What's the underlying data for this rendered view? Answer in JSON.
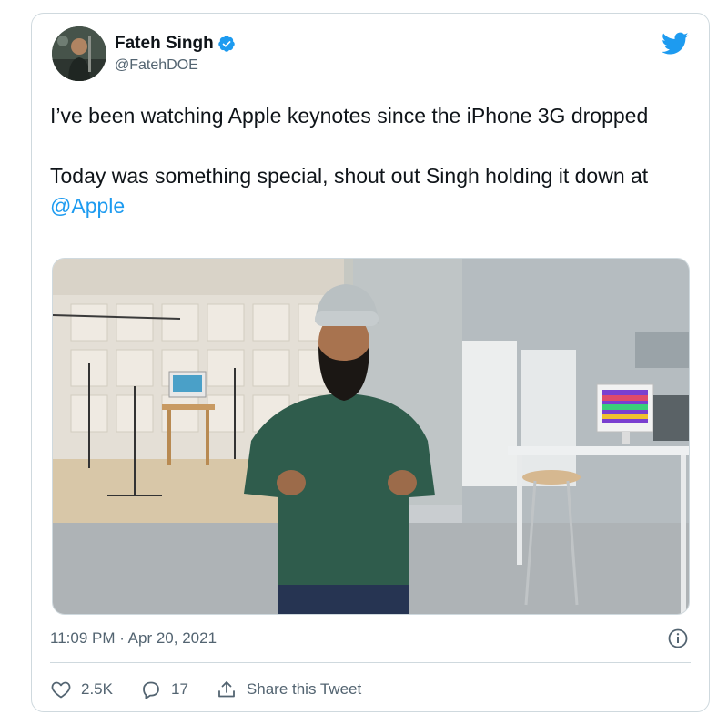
{
  "author": {
    "display_name": "Fateh Singh",
    "handle": "@FatehDOE",
    "verified": true,
    "avatar_icon": "profile-photo"
  },
  "brand": {
    "logo_icon": "twitter-bird-icon",
    "accent_color": "#1d9bf0"
  },
  "tweet": {
    "paragraph1": "I’ve been watching Apple keynotes since the iPhone 3G dropped",
    "paragraph2_prefix": "Today was something special, shout out Singh holding it down at ",
    "mention": "@Apple",
    "timestamp": "11:09 PM · Apr 20, 2021"
  },
  "media": {
    "type": "photo",
    "subject": "man-in-green-shirt-and-turban-in-studio"
  },
  "actions": {
    "like_count": "2.5K",
    "reply_count": "17",
    "share_label": "Share this Tweet"
  }
}
